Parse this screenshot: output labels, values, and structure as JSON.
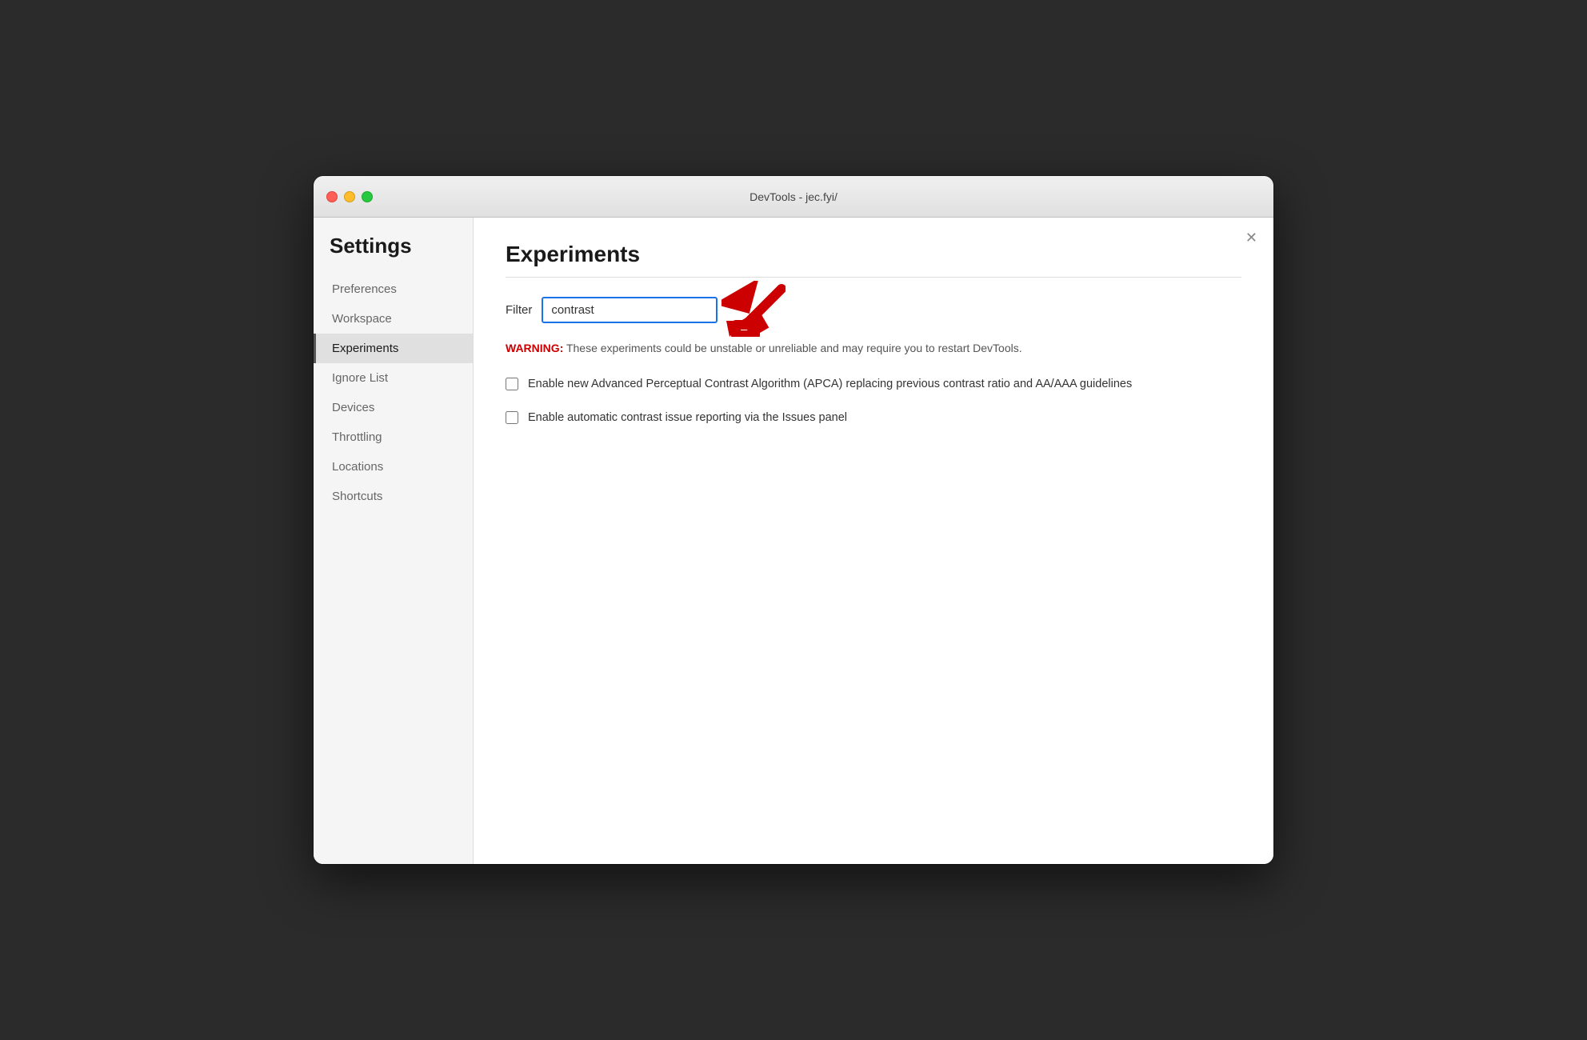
{
  "window": {
    "title": "DevTools - jec.fyi/"
  },
  "sidebar": {
    "title": "Settings",
    "items": [
      {
        "id": "preferences",
        "label": "Preferences",
        "active": false
      },
      {
        "id": "workspace",
        "label": "Workspace",
        "active": false
      },
      {
        "id": "experiments",
        "label": "Experiments",
        "active": true
      },
      {
        "id": "ignore-list",
        "label": "Ignore List",
        "active": false
      },
      {
        "id": "devices",
        "label": "Devices",
        "active": false
      },
      {
        "id": "throttling",
        "label": "Throttling",
        "active": false
      },
      {
        "id": "locations",
        "label": "Locations",
        "active": false
      },
      {
        "id": "shortcuts",
        "label": "Shortcuts",
        "active": false
      }
    ]
  },
  "main": {
    "page_title": "Experiments",
    "filter_label": "Filter",
    "filter_value": "contrast",
    "filter_placeholder": "",
    "warning_label": "WARNING:",
    "warning_text": " These experiments could be unstable or unreliable and may require you to restart DevTools.",
    "checkboxes": [
      {
        "id": "apca",
        "checked": false,
        "label": "Enable new Advanced Perceptual Contrast Algorithm (APCA) replacing previous contrast ratio and AA/AAA guidelines"
      },
      {
        "id": "contrast-issues",
        "checked": false,
        "label": "Enable automatic contrast issue reporting via the Issues panel"
      }
    ]
  }
}
